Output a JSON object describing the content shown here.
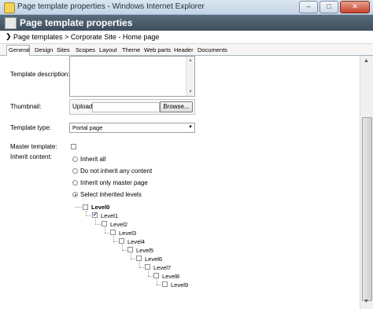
{
  "window": {
    "title": "Page template properties - Windows Internet Explorer",
    "buttons": [
      "–",
      "□",
      "✕"
    ]
  },
  "header": {
    "title": "Page template properties"
  },
  "breadcrumb": {
    "arrow": "❯",
    "items": [
      "Page templates",
      "Corporate Site - Home page"
    ],
    "text": "Page templates > Corporate Site - Home page"
  },
  "tabs": [
    {
      "label": "General",
      "active": true
    },
    {
      "label": "Design"
    },
    {
      "label": "Sites"
    },
    {
      "label": "Scopes"
    },
    {
      "label": "Layout"
    },
    {
      "label": "Theme"
    },
    {
      "label": "Web parts"
    },
    {
      "label": "Header"
    },
    {
      "label": "Documents"
    }
  ],
  "form": {
    "template_description_label": "Template description:",
    "thumbnail_label": "Thumbnail:",
    "upload_label": "Upload:",
    "browse_label": "Browse...",
    "template_type_label": "Template type:",
    "template_type_value": "Portal page",
    "master_template_label": "Master template:",
    "inherit_content_label": "Inherit content:",
    "inherit_options": [
      {
        "label": "Inherit all",
        "checked": false
      },
      {
        "label": "Do not inherit any content",
        "checked": false
      },
      {
        "label": "Inherit only master page",
        "checked": false
      },
      {
        "label": "Select inherited levels",
        "checked": true
      }
    ],
    "levels": [
      {
        "label": "Level0",
        "checked": false,
        "bold": true
      },
      {
        "label": "Level1",
        "checked": true
      },
      {
        "label": "Level2",
        "checked": false
      },
      {
        "label": "Level3",
        "checked": false
      },
      {
        "label": "Level4",
        "checked": false
      },
      {
        "label": "Level5",
        "checked": false
      },
      {
        "label": "Level6",
        "checked": false
      },
      {
        "label": "Level7",
        "checked": false
      },
      {
        "label": "Level8",
        "checked": false
      },
      {
        "label": "Level9",
        "checked": false
      }
    ]
  },
  "icons": {
    "check": "✔",
    "dropdown": "▼",
    "scroll_up": "▲",
    "scroll_down": "▼"
  }
}
